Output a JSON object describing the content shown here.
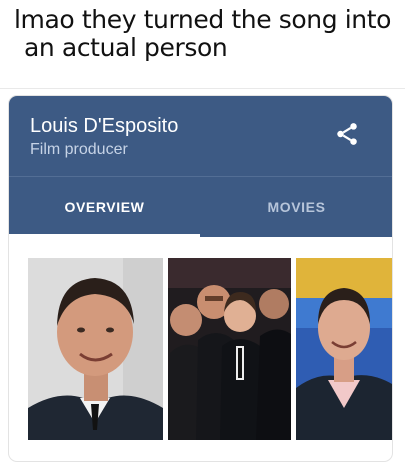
{
  "caption": {
    "line1": "lmao they turned the song into",
    "line2": "an actual person"
  },
  "knowledge_panel": {
    "name": "Louis D'Esposito",
    "subtitle": "Film producer",
    "share_icon": "share-icon",
    "tabs": [
      {
        "label": "OVERVIEW",
        "active": true
      },
      {
        "label": "MOVIES",
        "active": false
      }
    ],
    "photos": [
      {
        "subject": "portrait-photo"
      },
      {
        "subject": "group-photo"
      },
      {
        "subject": "premiere-photo"
      }
    ]
  },
  "colors": {
    "header_bg": "#3d5a84",
    "active_tab": "#ffffff",
    "inactive_tab": "#b7c5da"
  }
}
